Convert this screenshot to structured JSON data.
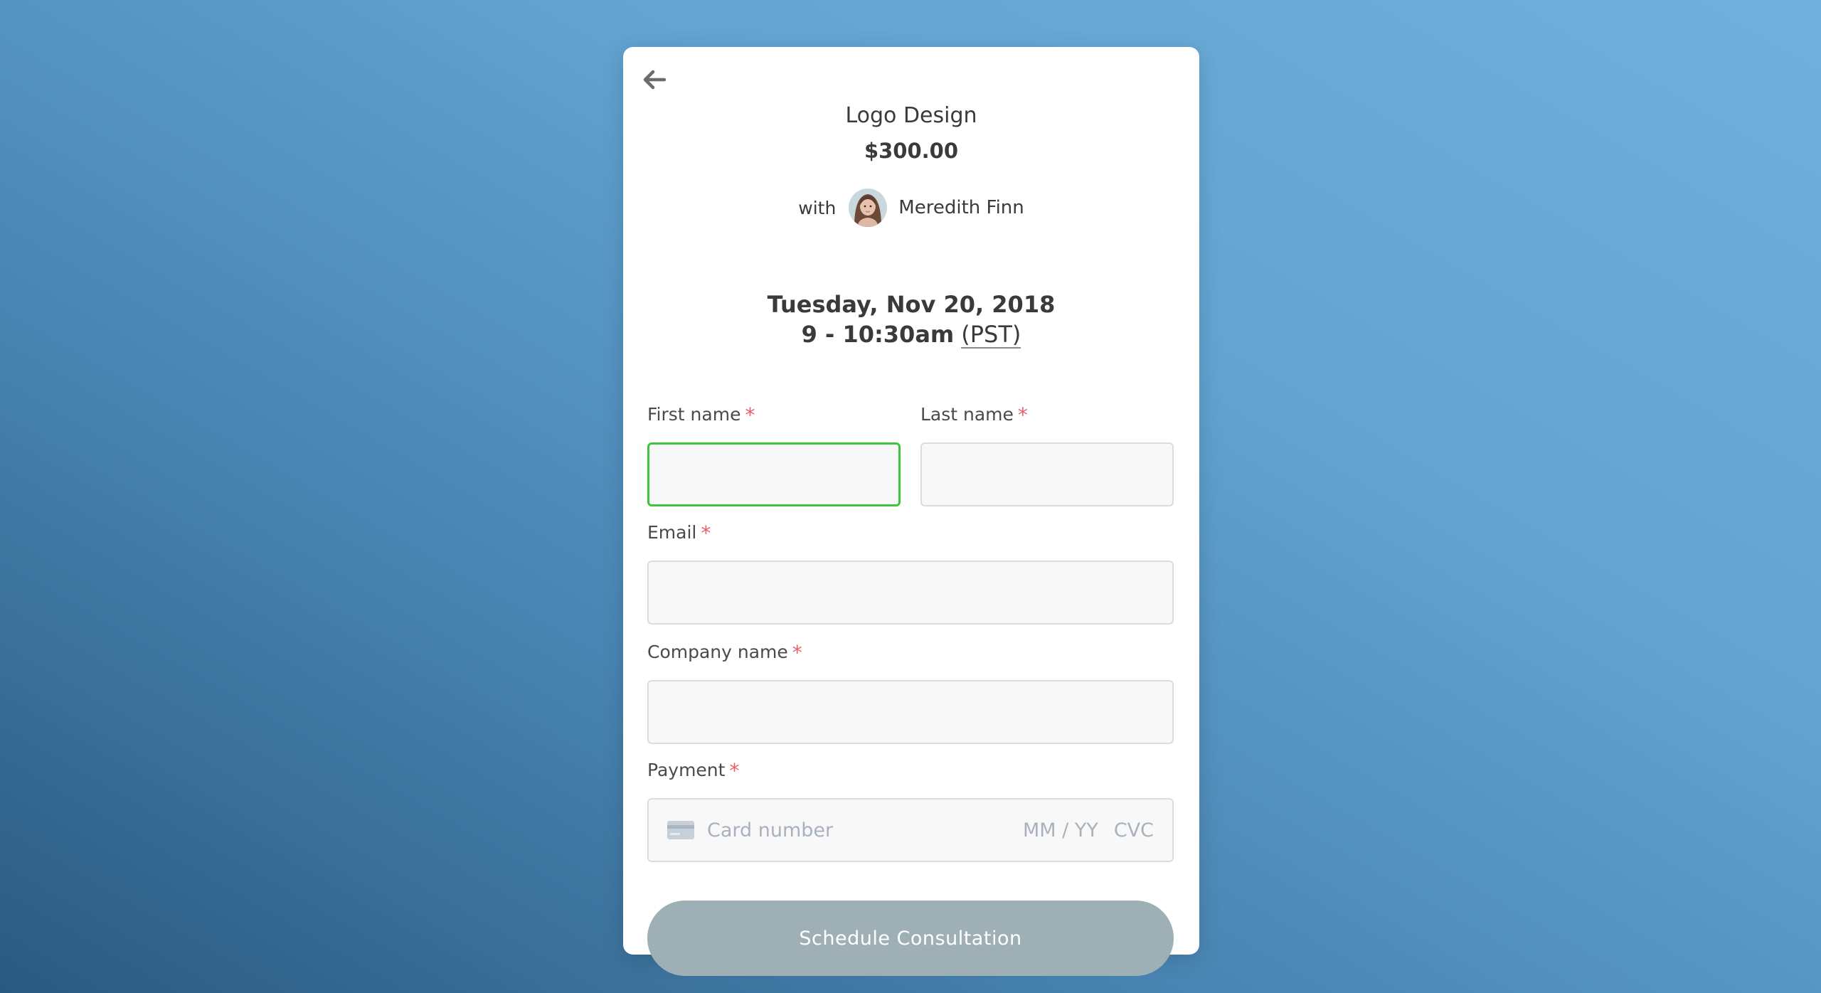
{
  "booking": {
    "service_name": "Logo Design",
    "price": "$300.00",
    "with_label": "with",
    "provider_name": "Meredith Finn",
    "date": "Tuesday, Nov 20, 2018",
    "time": "9 - 10:30am",
    "timezone": "(PST)"
  },
  "form": {
    "first_name_label": "First name",
    "last_name_label": "Last name",
    "email_label": "Email",
    "company_label": "Company name",
    "payment_label": "Payment",
    "required_mark": "*",
    "first_name_value": "",
    "last_name_value": "",
    "email_value": "",
    "company_value": "",
    "card_number_placeholder": "Card number",
    "expiry_placeholder": "MM / YY",
    "cvc_placeholder": "CVC",
    "submit_label": "Schedule Consultation"
  },
  "icons": {
    "back": "arrow-left-icon",
    "card": "credit-card-icon"
  },
  "colors": {
    "required": "#e8606a",
    "focus_border": "#3ec43e",
    "submit_disabled": "#9eb0b5",
    "placeholder": "#a8b2bd"
  }
}
